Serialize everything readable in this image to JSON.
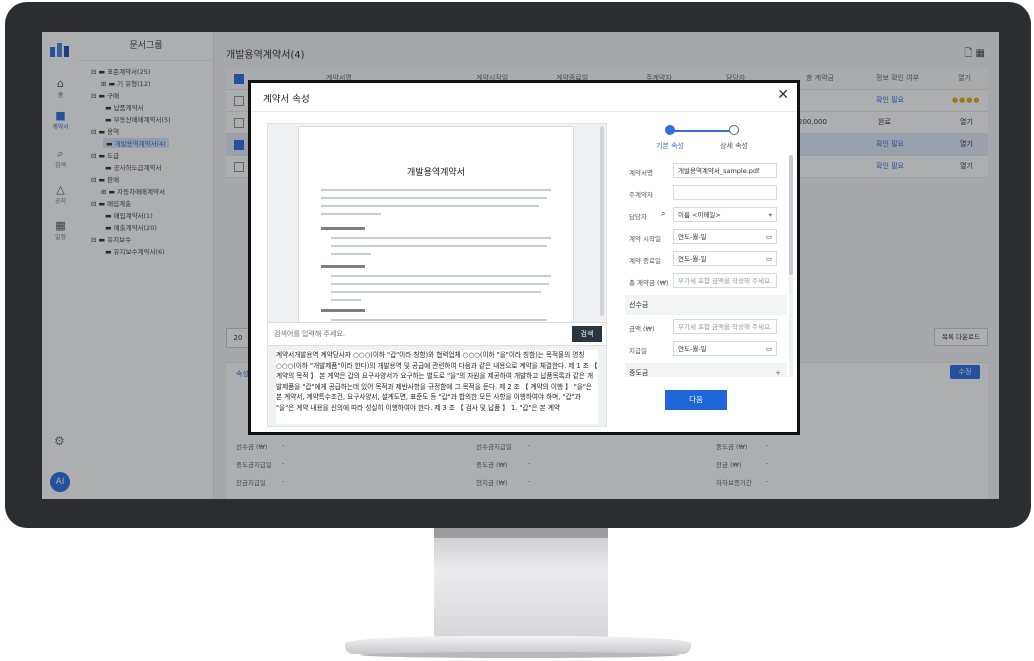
{
  "rail": {
    "items": [
      {
        "label": "홈",
        "icon": "home-icon"
      },
      {
        "label": "계약서",
        "icon": "briefcase-icon"
      },
      {
        "label": "검색",
        "icon": "search-icon"
      },
      {
        "label": "공지",
        "icon": "bell-icon"
      },
      {
        "label": "일정",
        "icon": "calendar-icon"
      }
    ],
    "avatar": "AI"
  },
  "tree": {
    "title": "문서그룹",
    "nodes": [
      {
        "label": "표준계약서(25)",
        "indent": 0
      },
      {
        "label": "기 유형(12)",
        "indent": 1
      },
      {
        "label": "구매",
        "indent": 0
      },
      {
        "label": "납품계약서",
        "indent": 1
      },
      {
        "label": "부동산매매계약서(5)",
        "indent": 1
      },
      {
        "label": "용역",
        "indent": 0
      },
      {
        "label": "개발용역계약서(4)",
        "indent": 1
      },
      {
        "label": "도급",
        "indent": 0
      },
      {
        "label": "공사하도급계약서",
        "indent": 1
      },
      {
        "label": "판매",
        "indent": 0
      },
      {
        "label": "자동차매매계약서",
        "indent": 1
      },
      {
        "label": "매입계출",
        "indent": 0
      },
      {
        "label": "매입계약서(1)",
        "indent": 1
      },
      {
        "label": "매출계약서(20)",
        "indent": 1
      },
      {
        "label": "유지보수",
        "indent": 0
      },
      {
        "label": "유지보수계약서(6)",
        "indent": 1
      }
    ]
  },
  "main": {
    "title": "개발용역계약서(4)",
    "columns": [
      "계약서명",
      "계약시작일",
      "계약종료일",
      "주계약자",
      "담당자",
      "총 계약금",
      "정보 확인 여부",
      "열기"
    ],
    "rows": [
      {
        "amount": "",
        "status": "",
        "open": "열기"
      },
      {
        "amount": "200,000",
        "status": "완료",
        "open": "열기"
      },
      {
        "amount": "",
        "status": "확인 필요",
        "open": "열기"
      },
      {
        "amount": "",
        "status": "확인 필요",
        "open": "열기"
      }
    ],
    "first_row_status": "확인 필요",
    "page_size": "20",
    "download_label": "목록 다운로드",
    "detail_tab": "속성",
    "edit_label": "수정",
    "detail_rows": [
      {
        "a": "선수금 (₩)",
        "b": "-",
        "c": "선수금지급일",
        "d": "-",
        "e": "중도금 (₩)",
        "f": "-"
      },
      {
        "a": "중도금지급일",
        "b": "-",
        "c": "중도금 (₩)",
        "d": "-",
        "e": "잔금 (₩)",
        "f": "-"
      },
      {
        "a": "잔금지급일",
        "b": "-",
        "c": "현지금 (₩)",
        "d": "-",
        "e": "하자보증기간",
        "f": "-"
      }
    ]
  },
  "modal": {
    "title": "계약서 속성",
    "steps": [
      "기본 속성",
      "상세 속성"
    ],
    "doc_title": "개발용역계약서",
    "search_placeholder": "검색어를 입력해 주세요.",
    "search_button": "검색",
    "preview_text": "계약서개발용역 계약당사자 ○○○(이하 \"갑\"이라 칭함)와 협력업체 ○○○(이하 \"을\"이라 칭함)는 목적물의 명칭○○○(이하 \"개발제품\"이라 한다)의 개발용역 및 공급에 관련하여 다음과 같은 내용으로 계약을 체결한다. 제 1 조 【 계약의 목적 】 본 계약은 갑의 요구사양서가 요구하는 별도로 \"을\"의 자원을 제공하여 개발하고 납품목록과 같은 개발제품을 \"갑\"에게 공급하는데 있어 목적과 제반사항을 규정함에 그 목적을 둔다. 제 2 조 【 계약의 이행 】 \"을\"은 본 계약서, 계약특수조건, 요구사양서, 설계도면, 표준도 등 \"갑\"과 합의한 모든 사항을 이행하여야 하며, \"갑\"과 \"을\"은 계약 내용을 신의에 따라 성실히 이행하여야 한다. 제 3 조 【 검사 및 납품 】 1. \"갑\"은 본 계약",
    "fields": [
      {
        "label": "계약서명",
        "value": "개발용역계약서_sample.pdf",
        "placeholder": ""
      },
      {
        "label": "주계약자",
        "value": "",
        "placeholder": ""
      },
      {
        "label": "담당자",
        "value": "이름 <이메일>",
        "placeholder": ""
      },
      {
        "label": "계약 시작일",
        "value": "연도-월-일",
        "placeholder": ""
      },
      {
        "label": "계약 종료일",
        "value": "연도-월-일",
        "placeholder": ""
      },
      {
        "label": "총 계약금 (₩)",
        "value": "",
        "placeholder": "부가세 포함 금액을 작성해 주세요."
      }
    ],
    "section_advance": "선수금",
    "advance_fields": [
      {
        "label": "금액 (₩)",
        "value": "",
        "placeholder": "부가세 포함 금액을 작성해 주세요."
      },
      {
        "label": "지급일",
        "value": "연도-월-일",
        "placeholder": ""
      }
    ],
    "section_middle": "중도금",
    "next_label": "다음",
    "close_icon": "close-icon",
    "accent": "#2f6fe0"
  }
}
